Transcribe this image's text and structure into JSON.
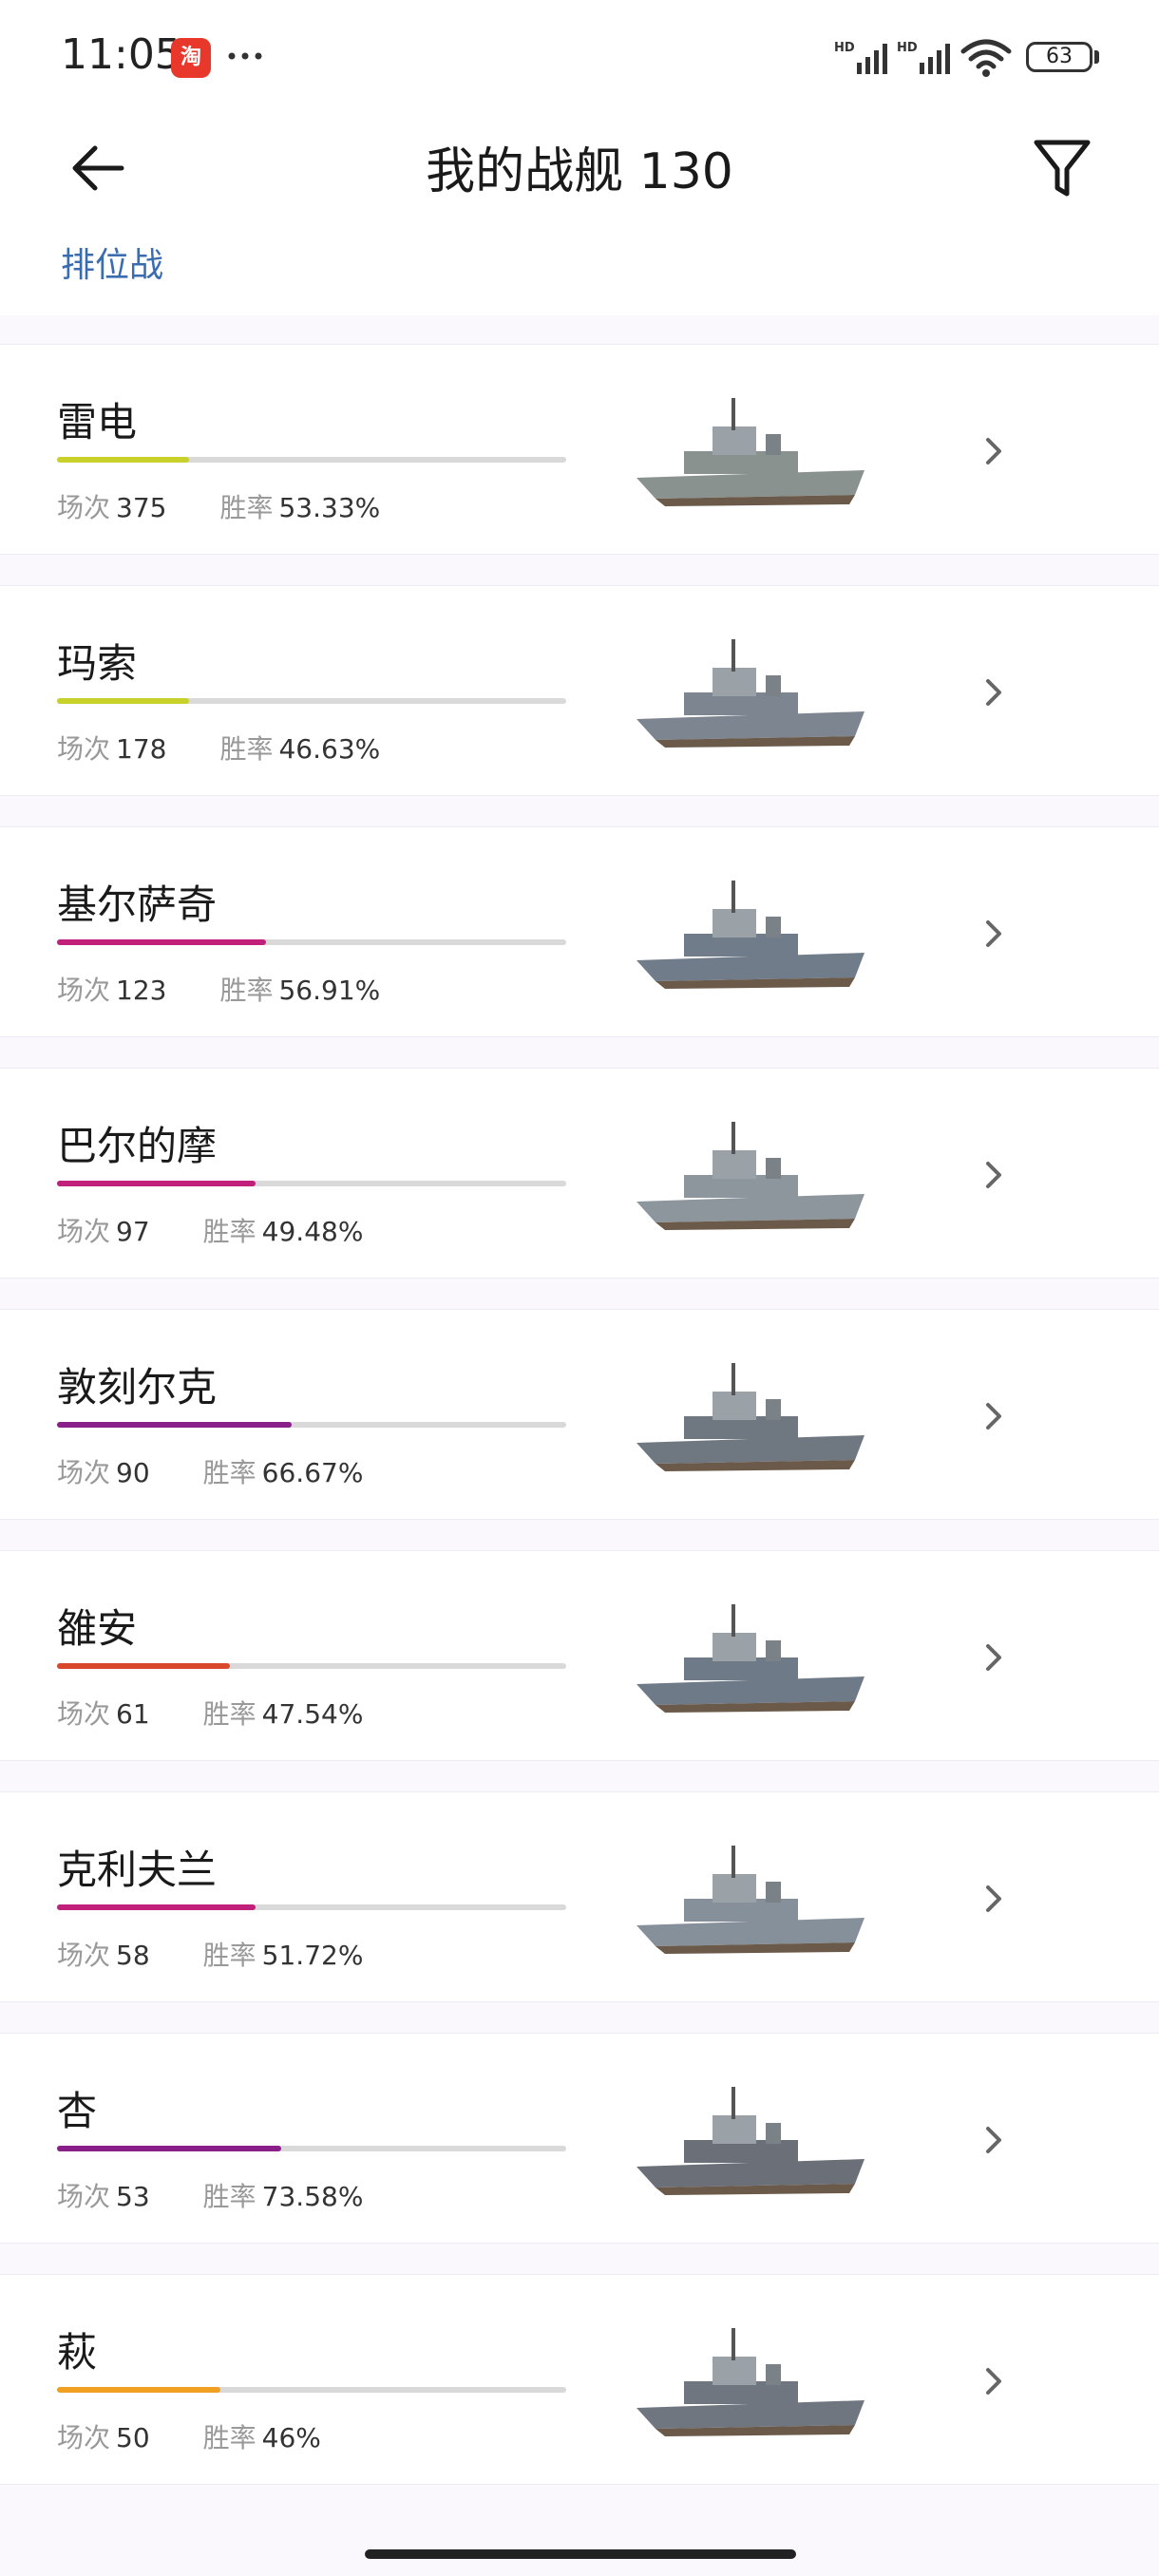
{
  "status_bar": {
    "time": "11:05",
    "app_badge": "淘",
    "battery": "63"
  },
  "header": {
    "title": "我的战舰 130",
    "sub_tab": "排位战"
  },
  "labels": {
    "battles": "场次",
    "win_rate": "胜率"
  },
  "ships": [
    {
      "name": "雷电",
      "battles": "375",
      "win_rate": "53.33%",
      "progress": 0.26,
      "bar_color": "#c8d02a",
      "hull": "#8a9290"
    },
    {
      "name": "玛索",
      "battles": "178",
      "win_rate": "46.63%",
      "progress": 0.26,
      "bar_color": "#c8d02a",
      "hull": "#7d8590"
    },
    {
      "name": "基尔萨奇",
      "battles": "123",
      "win_rate": "56.91%",
      "progress": 0.41,
      "bar_color": "#c0207a",
      "hull": "#707c8a"
    },
    {
      "name": "巴尔的摩",
      "battles": "97",
      "win_rate": "49.48%",
      "progress": 0.39,
      "bar_color": "#c0207a",
      "hull": "#8c969c"
    },
    {
      "name": "敦刻尔克",
      "battles": "90",
      "win_rate": "66.67%",
      "progress": 0.46,
      "bar_color": "#8a1f8a",
      "hull": "#6f7880"
    },
    {
      "name": "雒安",
      "battles": "61",
      "win_rate": "47.54%",
      "progress": 0.34,
      "bar_color": "#d9482a",
      "hull": "#6e7a88"
    },
    {
      "name": "克利夫兰",
      "battles": "58",
      "win_rate": "51.72%",
      "progress": 0.39,
      "bar_color": "#c0207a",
      "hull": "#86909a"
    },
    {
      "name": "杏",
      "battles": "53",
      "win_rate": "73.58%",
      "progress": 0.44,
      "bar_color": "#8a1f8a",
      "hull": "#6a6f78"
    },
    {
      "name": "萩",
      "battles": "50",
      "win_rate": "46%",
      "progress": 0.32,
      "bar_color": "#f0a020",
      "hull": "#707680"
    }
  ]
}
